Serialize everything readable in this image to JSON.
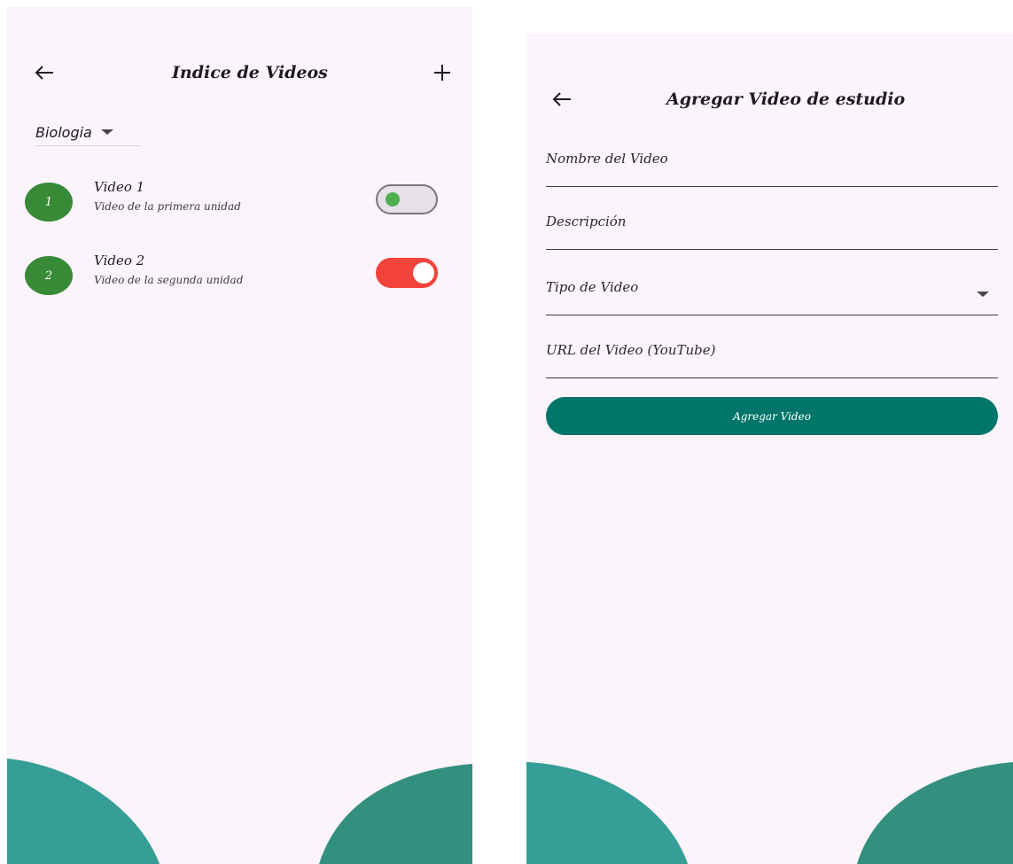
{
  "left_screen": {
    "title": "Indice de Videos",
    "subject_dropdown": {
      "selected": "Biologia"
    },
    "videos": [
      {
        "number": "1",
        "title": "Video 1",
        "description": "Video de la primera unidad",
        "toggle": "off"
      },
      {
        "number": "2",
        "title": "Video 2",
        "description": "Video de la segunda unidad",
        "toggle": "on"
      }
    ]
  },
  "right_screen": {
    "title": "Agregar Video de estudio",
    "fields": {
      "name_label": "Nombre del Video",
      "description_label": "Descripción",
      "type_label": "Tipo de Video",
      "url_label": "URL del Video (YouTube)"
    },
    "submit_label": "Agregar Video"
  },
  "colors": {
    "background": "#fbf4fb",
    "avatar_green": "#378a36",
    "toggle_off_dot": "#4caf50",
    "toggle_on_track": "#f2433b",
    "primary_button": "#00756a",
    "blob_left": "#359e96",
    "blob_right": "#33907f"
  },
  "icons": {
    "back": "arrow-left-icon",
    "add": "plus-icon",
    "dropdown": "caret-down-icon"
  }
}
